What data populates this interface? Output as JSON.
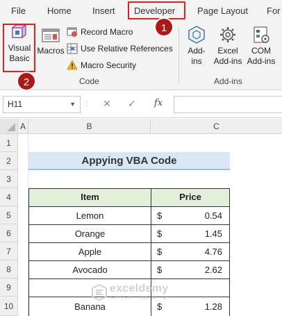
{
  "ribbon": {
    "tabs": [
      {
        "label": "File"
      },
      {
        "label": "Home"
      },
      {
        "label": "Insert"
      },
      {
        "label": "Developer",
        "highlighted": true
      },
      {
        "label": "Page Layout"
      },
      {
        "label": "For"
      }
    ],
    "code_group": {
      "visual_basic_label_line1": "Visual",
      "visual_basic_label_line2": "Basic",
      "macros_label": "Macros",
      "record_macro_label": "Record Macro",
      "relative_refs_label": "Use Relative References",
      "macro_security_label": "Macro Security",
      "group_label": "Code"
    },
    "addins_group": {
      "addins_line1": "Add-",
      "addins_line2": "ins",
      "excel_addins_line1": "Excel",
      "excel_addins_line2": "Add-ins",
      "com_addins_line1": "COM",
      "com_addins_line2": "Add-ins",
      "group_label": "Add-ins"
    },
    "step_badges": [
      "1",
      "2"
    ],
    "highlight_color": "#e02020",
    "badge_color": "#b01818"
  },
  "formula_bar": {
    "name_box": "H11",
    "cancel_icon": "✕",
    "enter_icon": "✓",
    "fx_label": "fx",
    "formula": ""
  },
  "grid": {
    "columns": [
      "A",
      "B",
      "C"
    ],
    "rows": [
      "1",
      "2",
      "3",
      "4",
      "5",
      "6",
      "7",
      "8",
      "9",
      "10"
    ]
  },
  "sheet": {
    "title": "Appying VBA Code",
    "title_fill": "#d9e6f3",
    "table": {
      "headers": [
        "Item",
        "Price"
      ],
      "header_fill": "#e2efd9",
      "rows": [
        {
          "item": "Lemon",
          "currency": "$",
          "price": "0.54"
        },
        {
          "item": "Orange",
          "currency": "$",
          "price": "1.45"
        },
        {
          "item": "Apple",
          "currency": "$",
          "price": "4.76"
        },
        {
          "item": "Avocado",
          "currency": "$",
          "price": "2.62"
        },
        {
          "item": "",
          "currency": "",
          "price": ""
        },
        {
          "item": "Banana",
          "currency": "$",
          "price": "1.28"
        }
      ]
    }
  },
  "watermark": {
    "name": "exceldemy",
    "tagline": "EXCEL · DATA · BI"
  }
}
